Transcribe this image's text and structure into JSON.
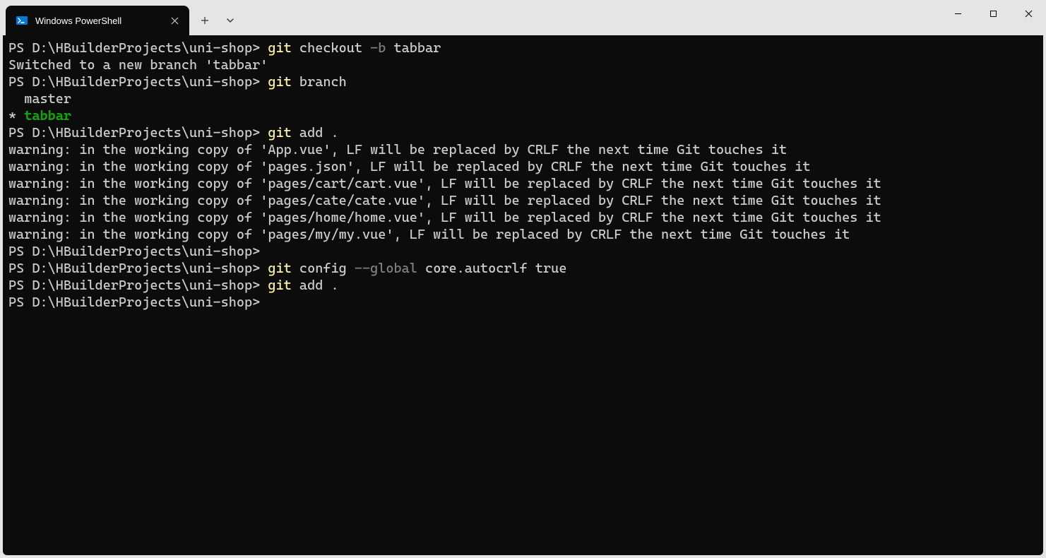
{
  "tab": {
    "title": "Windows PowerShell"
  },
  "prompt": "PS D:\\HBuilderProjects\\uni-shop>",
  "lines": {
    "l0_cmd_git": "git",
    "l0_cmd_rest": " checkout ",
    "l0_cmd_flag": "-b",
    "l0_cmd_arg": " tabbar",
    "l1": "Switched to a new branch 'tabbar'",
    "l2_cmd_git": "git",
    "l2_cmd_rest": " branch",
    "l3": "  master",
    "l4_star": "* ",
    "l4_branch": "tabbar",
    "l5_cmd_git": "git",
    "l5_cmd_rest": " add .",
    "l6": "warning: in the working copy of 'App.vue', LF will be replaced by CRLF the next time Git touches it",
    "l7": "warning: in the working copy of 'pages.json', LF will be replaced by CRLF the next time Git touches it",
    "l8": "warning: in the working copy of 'pages/cart/cart.vue', LF will be replaced by CRLF the next time Git touches it",
    "l9": "warning: in the working copy of 'pages/cate/cate.vue', LF will be replaced by CRLF the next time Git touches it",
    "l10": "warning: in the working copy of 'pages/home/home.vue', LF will be replaced by CRLF the next time Git touches it",
    "l11": "warning: in the working copy of 'pages/my/my.vue', LF will be replaced by CRLF the next time Git touches it",
    "l13_cmd_git": "git",
    "l13_cmd_rest": " config ",
    "l13_cmd_flag": "--global",
    "l13_cmd_arg": " core.autocrlf true",
    "l14_cmd_git": "git",
    "l14_cmd_rest": " add ."
  }
}
